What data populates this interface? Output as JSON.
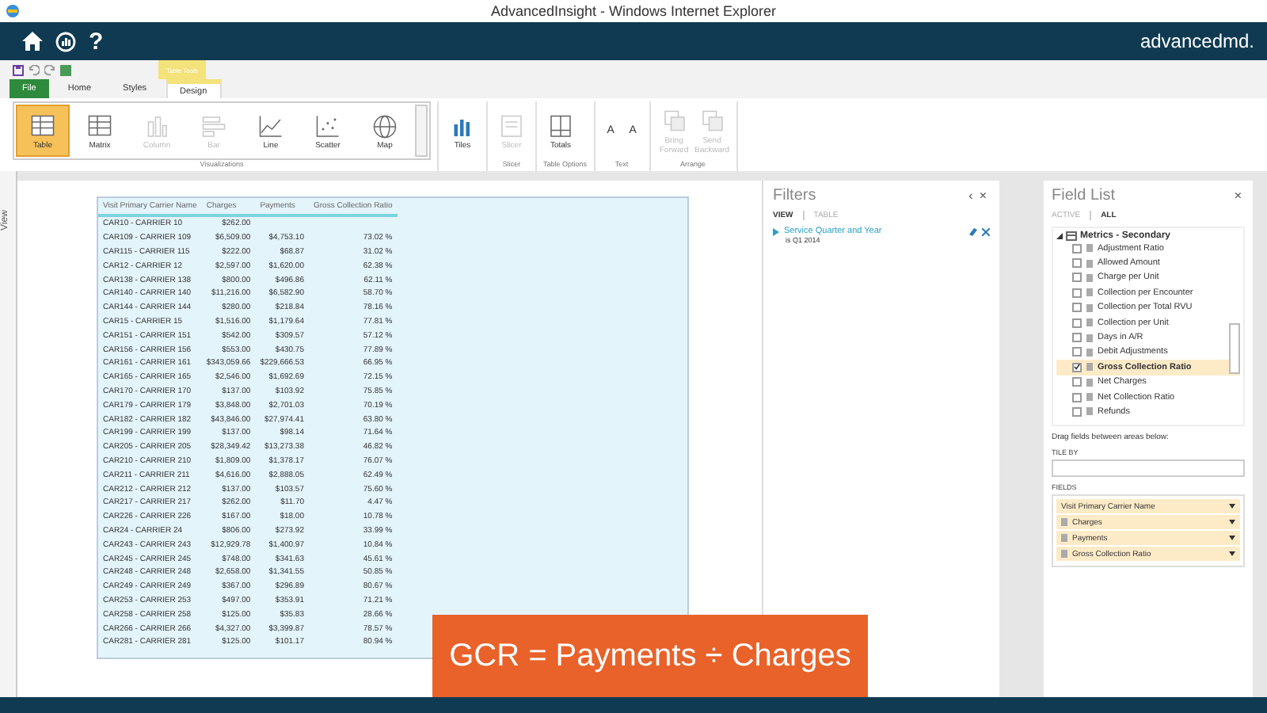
{
  "window": {
    "title": "AdvancedInsight - Windows Internet Explorer"
  },
  "brand": {
    "logo": "advancedmd."
  },
  "nav": {
    "help": "?"
  },
  "ribbon": {
    "context_label": "Table Tools",
    "tabs": [
      {
        "label": "File",
        "kind": "file",
        "selected": false
      },
      {
        "label": "Home",
        "kind": "plain",
        "selected": false
      },
      {
        "label": "Styles",
        "kind": "plain",
        "selected": false
      },
      {
        "label": "Design",
        "kind": "plain",
        "selected": true
      }
    ],
    "groups": [
      {
        "label": "Visualizations",
        "kind": "gallery",
        "buttons": [
          {
            "label": "Table",
            "kind": "table",
            "selected": true,
            "disabled": false
          },
          {
            "label": "Matrix",
            "kind": "table",
            "selected": false,
            "disabled": false
          },
          {
            "label": "Column",
            "kind": "column",
            "selected": false,
            "disabled": true
          },
          {
            "label": "Bar",
            "kind": "bar",
            "selected": false,
            "disabled": true
          },
          {
            "label": "Line",
            "kind": "line",
            "selected": false,
            "disabled": false
          },
          {
            "label": "Scatter",
            "kind": "scatter",
            "selected": false,
            "disabled": false
          },
          {
            "label": "Map",
            "kind": "globe",
            "selected": false,
            "disabled": false
          }
        ]
      },
      {
        "kind": "plain",
        "buttons": [
          {
            "label": "Tiles",
            "kind": "tiles",
            "selected": false,
            "disabled": false
          }
        ]
      },
      {
        "label": "Slicer",
        "kind": "plain",
        "buttons": [
          {
            "label": "Slicer",
            "kind": "slicer",
            "selected": false,
            "disabled": true
          }
        ]
      },
      {
        "label": "Table Options",
        "kind": "plain",
        "buttons": [
          {
            "label": "Totals",
            "kind": "totals",
            "selected": false,
            "disabled": false
          }
        ]
      },
      {
        "label": "Text",
        "kind": "text",
        "buttons": [
          {
            "label": "A",
            "kind": "letter",
            "selected": false,
            "disabled": false
          },
          {
            "label": "A",
            "kind": "letter",
            "selected": false,
            "disabled": false
          }
        ]
      },
      {
        "label": "Arrange",
        "kind": "plain",
        "buttons": [
          {
            "label": "Bring Forward",
            "kind": "arrange",
            "selected": false,
            "disabled": true
          },
          {
            "label": "Send Backward",
            "kind": "arrange",
            "selected": false,
            "disabled": true
          }
        ]
      }
    ]
  },
  "view_strip": {
    "label": "View"
  },
  "table": {
    "columns": [
      "Visit Primary Carrier Name",
      "Charges",
      "Payments",
      "Gross Collection Ratio"
    ],
    "rows": [
      [
        "CAR10 - CARRIER 10",
        "$262.00",
        "",
        ""
      ],
      [
        "CAR109 - CARRIER 109",
        "$6,509.00",
        "$4,753.10",
        "73.02 %"
      ],
      [
        "CAR115 - CARRIER 115",
        "$222.00",
        "$68.87",
        "31.02 %"
      ],
      [
        "CAR12 - CARRIER 12",
        "$2,597.00",
        "$1,620.00",
        "62.38 %"
      ],
      [
        "CAR138 - CARRIER 138",
        "$800.00",
        "$496.86",
        "62.11 %"
      ],
      [
        "CAR140 - CARRIER 140",
        "$11,216.00",
        "$6,582.90",
        "58.70 %"
      ],
      [
        "CAR144 - CARRIER 144",
        "$280.00",
        "$218.84",
        "78.16 %"
      ],
      [
        "CAR15 - CARRIER 15",
        "$1,516.00",
        "$1,179.64",
        "77.81 %"
      ],
      [
        "CAR151 - CARRIER 151",
        "$542.00",
        "$309.57",
        "57.12 %"
      ],
      [
        "CAR156 - CARRIER 156",
        "$553.00",
        "$430.75",
        "77.89 %"
      ],
      [
        "CAR161 - CARRIER 161",
        "$343,059.66",
        "$229,666.53",
        "66.95 %"
      ],
      [
        "CAR165 - CARRIER 165",
        "$2,546.00",
        "$1,692.69",
        "72.15 %"
      ],
      [
        "CAR170 - CARRIER 170",
        "$137.00",
        "$103.92",
        "75.85 %"
      ],
      [
        "CAR179 - CARRIER 179",
        "$3,848.00",
        "$2,701.03",
        "70.19 %"
      ],
      [
        "CAR182 - CARRIER 182",
        "$43,846.00",
        "$27,974.41",
        "63.80 %"
      ],
      [
        "CAR199 - CARRIER 199",
        "$137.00",
        "$98.14",
        "71.64 %"
      ],
      [
        "CAR205 - CARRIER 205",
        "$28,349.42",
        "$13,273.38",
        "46.82 %"
      ],
      [
        "CAR210 - CARRIER 210",
        "$1,809.00",
        "$1,378.17",
        "76.07 %"
      ],
      [
        "CAR211 - CARRIER 211",
        "$4,616.00",
        "$2,888.05",
        "62.49 %"
      ],
      [
        "CAR212 - CARRIER 212",
        "$137.00",
        "$103.57",
        "75.60 %"
      ],
      [
        "CAR217 - CARRIER 217",
        "$262.00",
        "$11.70",
        "4.47 %"
      ],
      [
        "CAR226 - CARRIER 226",
        "$167.00",
        "$18.00",
        "10.78 %"
      ],
      [
        "CAR24 - CARRIER 24",
        "$806.00",
        "$273.92",
        "33.99 %"
      ],
      [
        "CAR243 - CARRIER 243",
        "$12,929.78",
        "$1,400.97",
        "10.84 %"
      ],
      [
        "CAR245 - CARRIER 245",
        "$748.00",
        "$341.63",
        "45.61 %"
      ],
      [
        "CAR248 - CARRIER 248",
        "$2,658.00",
        "$1,341.55",
        "50.85 %"
      ],
      [
        "CAR249 - CARRIER 249",
        "$367.00",
        "$296.89",
        "80.67 %"
      ],
      [
        "CAR253 - CARRIER 253",
        "$497.00",
        "$353.91",
        "71.21 %"
      ],
      [
        "CAR258 - CARRIER 258",
        "$125.00",
        "$35.83",
        "28.66 %"
      ],
      [
        "CAR266 - CARRIER 266",
        "$4,327.00",
        "$3,399.87",
        "78.57 %"
      ],
      [
        "CAR281 - CARRIER 281",
        "$125.00",
        "$101.17",
        "80.94 %"
      ]
    ]
  },
  "filters": {
    "title": "Filters",
    "collapse": "‹",
    "close": "×",
    "tabs": [
      {
        "label": "VIEW",
        "selected": true
      },
      {
        "label": "TABLE",
        "selected": false
      }
    ],
    "items": [
      {
        "field": "Service Quarter and Year",
        "condition": "is Q1 2014"
      }
    ]
  },
  "field_list": {
    "title": "Field List",
    "close": "×",
    "tabs": [
      {
        "label": "ACTIVE",
        "selected": false
      },
      {
        "label": "ALL",
        "selected": true
      }
    ],
    "tree": [
      {
        "label": "Metrics - Secondary",
        "expanded": true,
        "children": [
          {
            "label": "Adjustment Ratio",
            "checked": false
          },
          {
            "label": "Allowed Amount",
            "checked": false
          },
          {
            "label": "Charge per Unit",
            "checked": false
          },
          {
            "label": "Collection per Encounter",
            "checked": false
          },
          {
            "label": "Collection per Total RVU",
            "checked": false
          },
          {
            "label": "Collection per Unit",
            "checked": false
          },
          {
            "label": "Days in A/R",
            "checked": false
          },
          {
            "label": "Debit Adjustments",
            "checked": false
          },
          {
            "label": "Gross Collection Ratio",
            "checked": true
          },
          {
            "label": "Net Charges",
            "checked": false
          },
          {
            "label": "Net Collection Ratio",
            "checked": false
          },
          {
            "label": "Refunds",
            "checked": false
          }
        ]
      }
    ],
    "hint": "Drag fields between areas below:",
    "tile_by_label": "TILE BY",
    "fields_label": "FIELDS",
    "fields": [
      {
        "label": "Visit Primary Carrier Name",
        "kind": "text"
      },
      {
        "label": "Charges",
        "kind": "measure"
      },
      {
        "label": "Payments",
        "kind": "measure"
      },
      {
        "label": "Gross Collection Ratio",
        "kind": "measure"
      }
    ]
  },
  "caption": {
    "text": "GCR = Payments ÷ Charges"
  }
}
